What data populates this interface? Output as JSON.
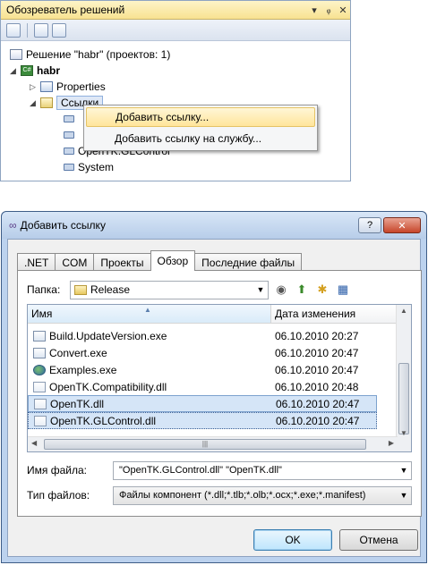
{
  "solution_explorer": {
    "title": "Обозреватель решений",
    "title_controls": [
      "▾",
      "ᵩ",
      "✕"
    ],
    "solution_label": "Решение \"habr\"  (проектов: 1)",
    "project": "habr",
    "project_icon_text": "C#",
    "nodes": {
      "properties": "Properties",
      "references": "Ссылки",
      "ref_glcontrol": "OpenTK.GLControl",
      "ref_system": "System"
    }
  },
  "context_menu": {
    "items": [
      "Добавить ссылку...",
      "Добавить ссылку на службу..."
    ]
  },
  "dialog": {
    "title": "Добавить ссылку",
    "help_btn": "?",
    "close_btn": "✕",
    "tabs": [
      ".NET",
      "COM",
      "Проекты",
      "Обзор",
      "Последние файлы"
    ],
    "active_tab": "Обзор",
    "folder_label": "Папка:",
    "folder_value": "Release",
    "columns": {
      "name": "Имя",
      "date": "Дата изменения"
    },
    "files": [
      {
        "name": "Build.UpdateVersion.exe",
        "date": "06.10.2010 20:27",
        "icon": "exe-icon"
      },
      {
        "name": "Convert.exe",
        "date": "06.10.2010 20:47",
        "icon": "exe-icon"
      },
      {
        "name": "Examples.exe",
        "date": "06.10.2010 20:47",
        "icon": "globe-icon"
      },
      {
        "name": "OpenTK.Compatibility.dll",
        "date": "06.10.2010 20:48",
        "icon": "dll-icon"
      },
      {
        "name": "OpenTK.dll",
        "date": "06.10.2010 20:47",
        "icon": "dll-icon"
      },
      {
        "name": "OpenTK.GLControl.dll",
        "date": "06.10.2010 20:47",
        "icon": "dll-icon"
      }
    ],
    "filename_label": "Имя файла:",
    "filename_value": "\"OpenTK.GLControl.dll\" \"OpenTK.dll\"",
    "filetype_label": "Тип файлов:",
    "filetype_value": "Файлы компонент (*.dll;*.tlb;*.olb;*.ocx;*.exe;*.manifest)",
    "ok": "OK",
    "cancel": "Отмена"
  },
  "colors": {
    "selection": "#d5e5f7",
    "menu_hover": "#ffe59a",
    "title_bar": "#f8e291"
  }
}
